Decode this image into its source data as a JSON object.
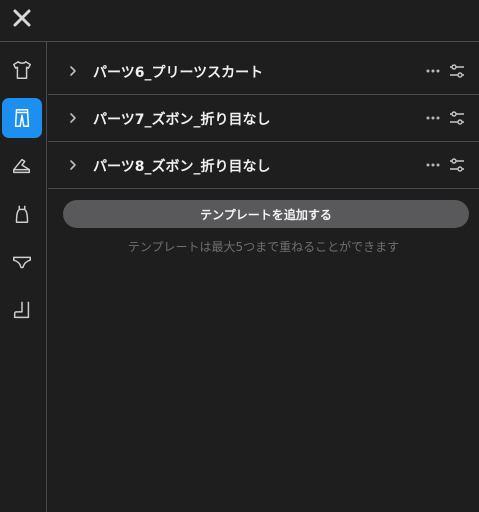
{
  "topbar": {
    "close_icon": "close-icon"
  },
  "sidebar": {
    "items": [
      {
        "icon": "shirt-icon",
        "active": false
      },
      {
        "icon": "pants-icon",
        "active": true
      },
      {
        "icon": "shoe-icon",
        "active": false
      },
      {
        "icon": "dress-icon",
        "active": false
      },
      {
        "icon": "underwear-icon",
        "active": false
      },
      {
        "icon": "boot-icon",
        "active": false
      }
    ],
    "accent_color": "#1d8ff0"
  },
  "parts": [
    {
      "label": "パーツ6_プリーツスカート"
    },
    {
      "label": "パーツ7_ズボン_折り目なし"
    },
    {
      "label": "パーツ8_ズボン_折り目なし"
    }
  ],
  "template": {
    "add_label": "テンプレートを追加する",
    "hint": "テンプレートは最大5つまで重ねることができます"
  }
}
